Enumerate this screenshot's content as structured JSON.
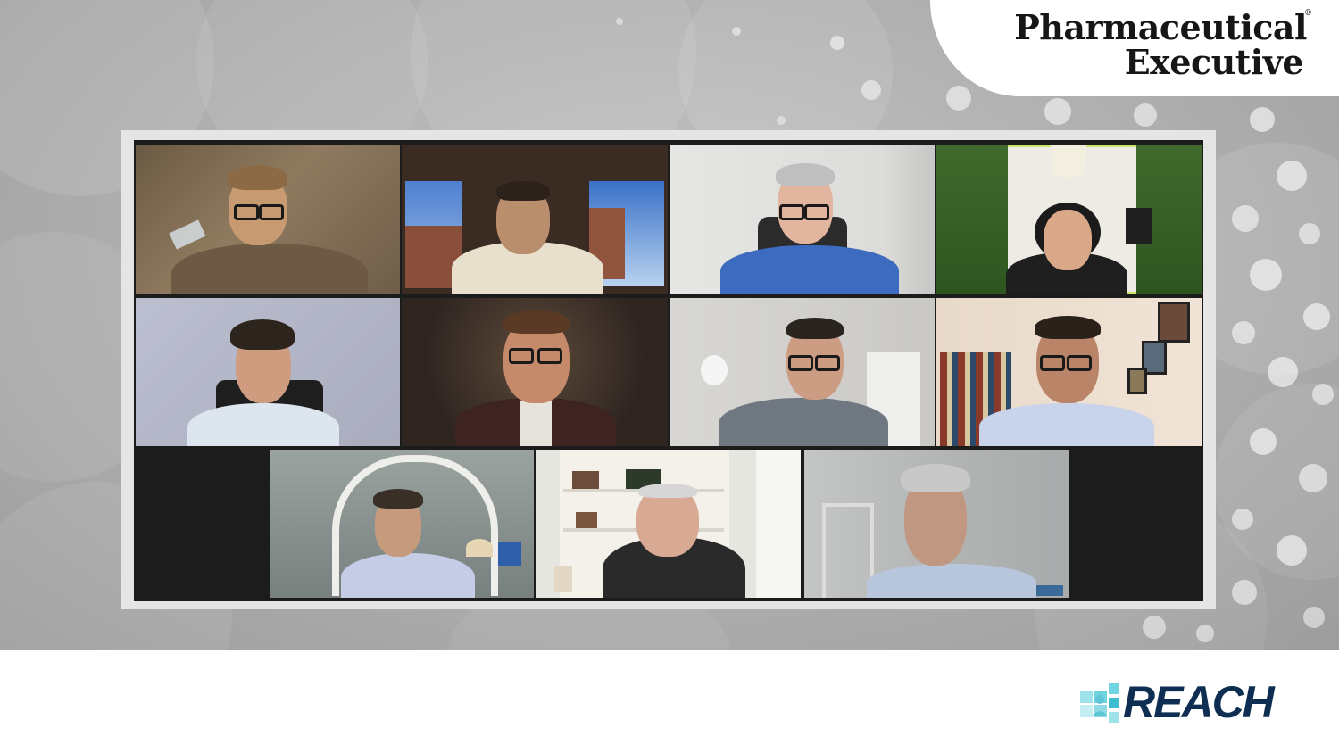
{
  "brand": {
    "line1": "Pharmaceutical",
    "line2": "Executive",
    "registered": "®"
  },
  "footer_logo": {
    "text": "REACH",
    "color": "#0f2f52",
    "accent": "#6fd3e0"
  },
  "meeting": {
    "layout": "gallery",
    "participant_count": 11,
    "active_speaker_color": "#c7e66a",
    "active_speaker_tile": 4
  }
}
